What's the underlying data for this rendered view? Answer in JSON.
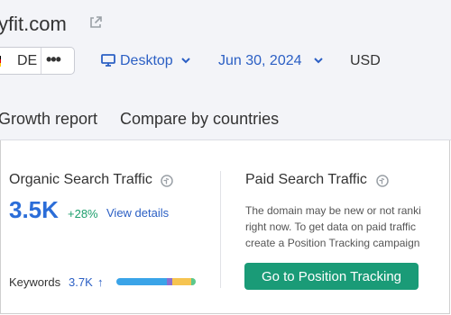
{
  "header": {
    "domain": "yfit.com",
    "database": {
      "label": "DE",
      "more": "•••"
    },
    "device": "Desktop",
    "date": "Jun 30, 2024",
    "currency": "USD"
  },
  "tabs": [
    {
      "label": "Growth report"
    },
    {
      "label": "Compare by countries"
    }
  ],
  "organic": {
    "title": "Organic Search Traffic",
    "value": "3.5K",
    "change": "+28%",
    "link": "View details",
    "keywords_label": "Keywords",
    "keywords_value": "3.7K",
    "keywords_arrow": "↑",
    "bar_segments": [
      {
        "share": 0.64,
        "color": "#3aa4e8"
      },
      {
        "share": 0.06,
        "color": "#8b6fd0"
      },
      {
        "share": 0.24,
        "color": "#f6c451"
      },
      {
        "share": 0.06,
        "color": "#5cc88c"
      }
    ]
  },
  "paid": {
    "title": "Paid Search Traffic",
    "desc_lines": [
      "The domain may be new or not ranki",
      "right now. To get data on paid traffic",
      "create a Position Tracking campaign"
    ],
    "cta": "Go to Position Tracking"
  },
  "colors": {
    "accent": "#2b6dd8",
    "link": "#2b5fc4",
    "positive": "#1c9e6c",
    "cta": "#1a9b77"
  }
}
